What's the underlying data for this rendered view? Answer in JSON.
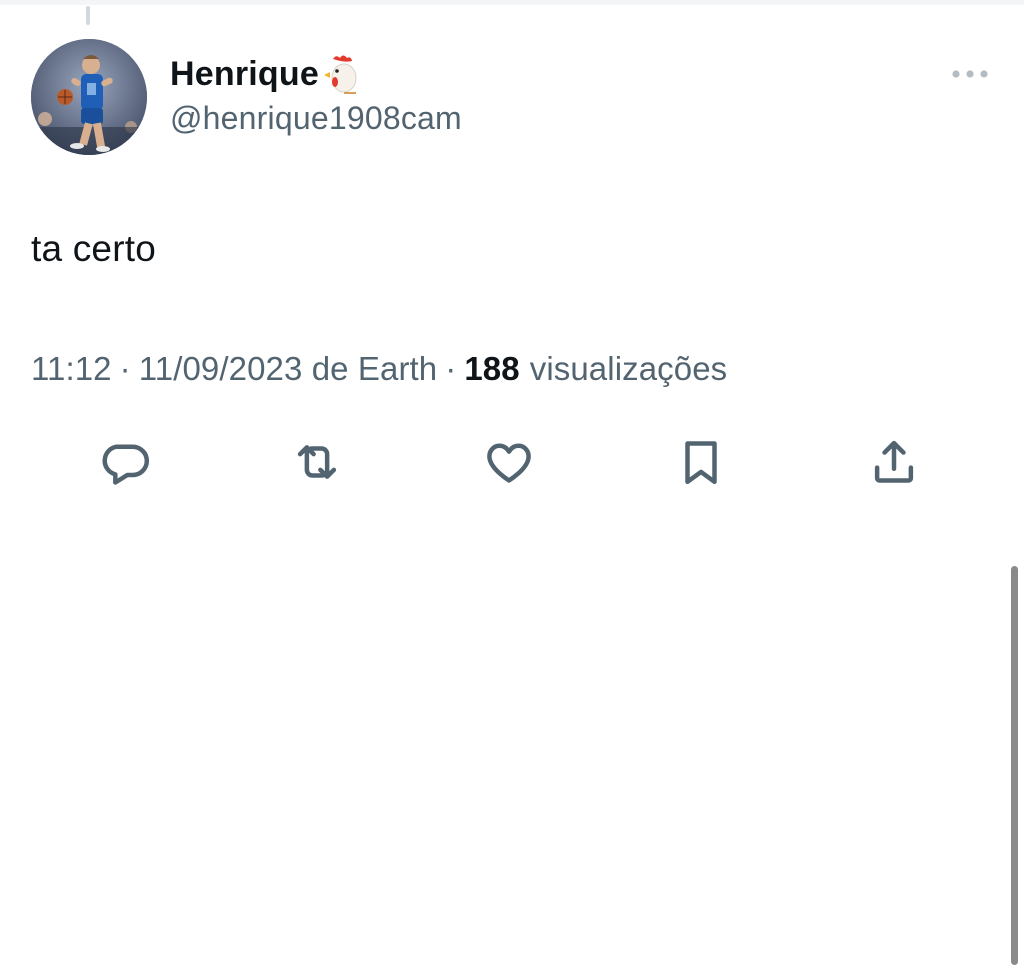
{
  "tweet": {
    "author": {
      "display_name": "Henrique",
      "name_emoji_icon": "rooster-emoji-icon",
      "handle": "@henrique1908cam",
      "avatar_icon": "basketball-player-avatar"
    },
    "text": "ta certo",
    "meta": {
      "time": "11:12",
      "separator": "·",
      "date_source": "11/09/2023 de Earth",
      "views_count": "188",
      "views_label": "visualizações"
    },
    "actions": [
      {
        "icon": "reply-icon"
      },
      {
        "icon": "retweet-icon"
      },
      {
        "icon": "like-icon"
      },
      {
        "icon": "bookmark-icon"
      },
      {
        "icon": "share-icon"
      }
    ],
    "more_menu_icon": "more-horizontal-icon"
  },
  "colors": {
    "text_primary": "#0f1419",
    "text_secondary": "#536471",
    "icon": "#536471",
    "thread_line": "#cfd9de",
    "scrollbar": "#8a8a8a",
    "background": "#ffffff"
  }
}
